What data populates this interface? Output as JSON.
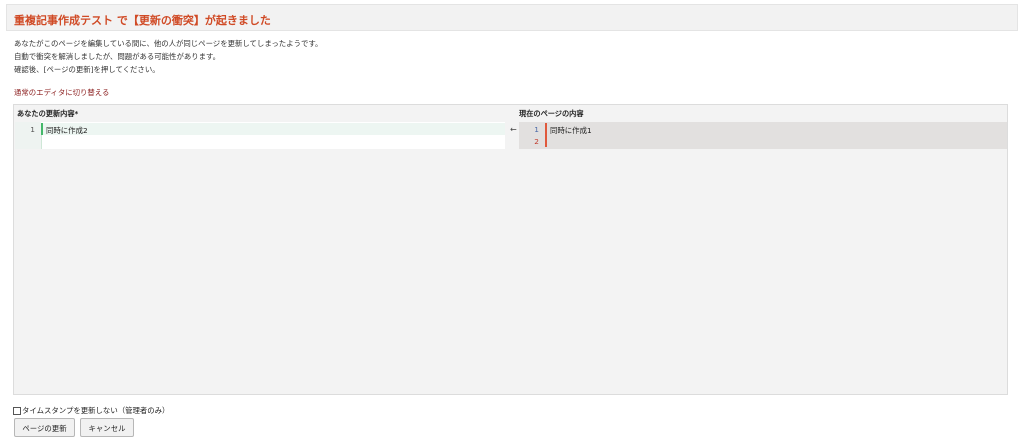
{
  "header": {
    "title": "重複記事作成テスト で【更新の衝突】が起きました"
  },
  "message": {
    "line1": "あなたがこのページを編集している間に、他の人が同じページを更新してしまったようです。",
    "line2": "自動で衝突を解消しましたが、問題がある可能性があります。",
    "line3": "確認後、[ページの更新]を押してください。"
  },
  "switch_editor_link": "通常のエディタに切り替える",
  "merge": {
    "left_header": "あなたの更新内容*",
    "right_header": "現在のページの内容",
    "left_lines": [
      {
        "num": "1",
        "text": "同時に作成2"
      }
    ],
    "right_lines": [
      {
        "num": "1",
        "text": "同時に作成1"
      },
      {
        "num": "2",
        "text": ""
      }
    ],
    "merge_arrow": "←"
  },
  "timestamp_option": "タイムスタンプを更新しない（管理者のみ）",
  "buttons": {
    "update": "ページの更新",
    "cancel": "キャンセル"
  },
  "colors": {
    "title": "#d04a25",
    "link": "#8a1c1c",
    "added_marker": "#44b86a",
    "changed_marker": "#e0593c"
  }
}
